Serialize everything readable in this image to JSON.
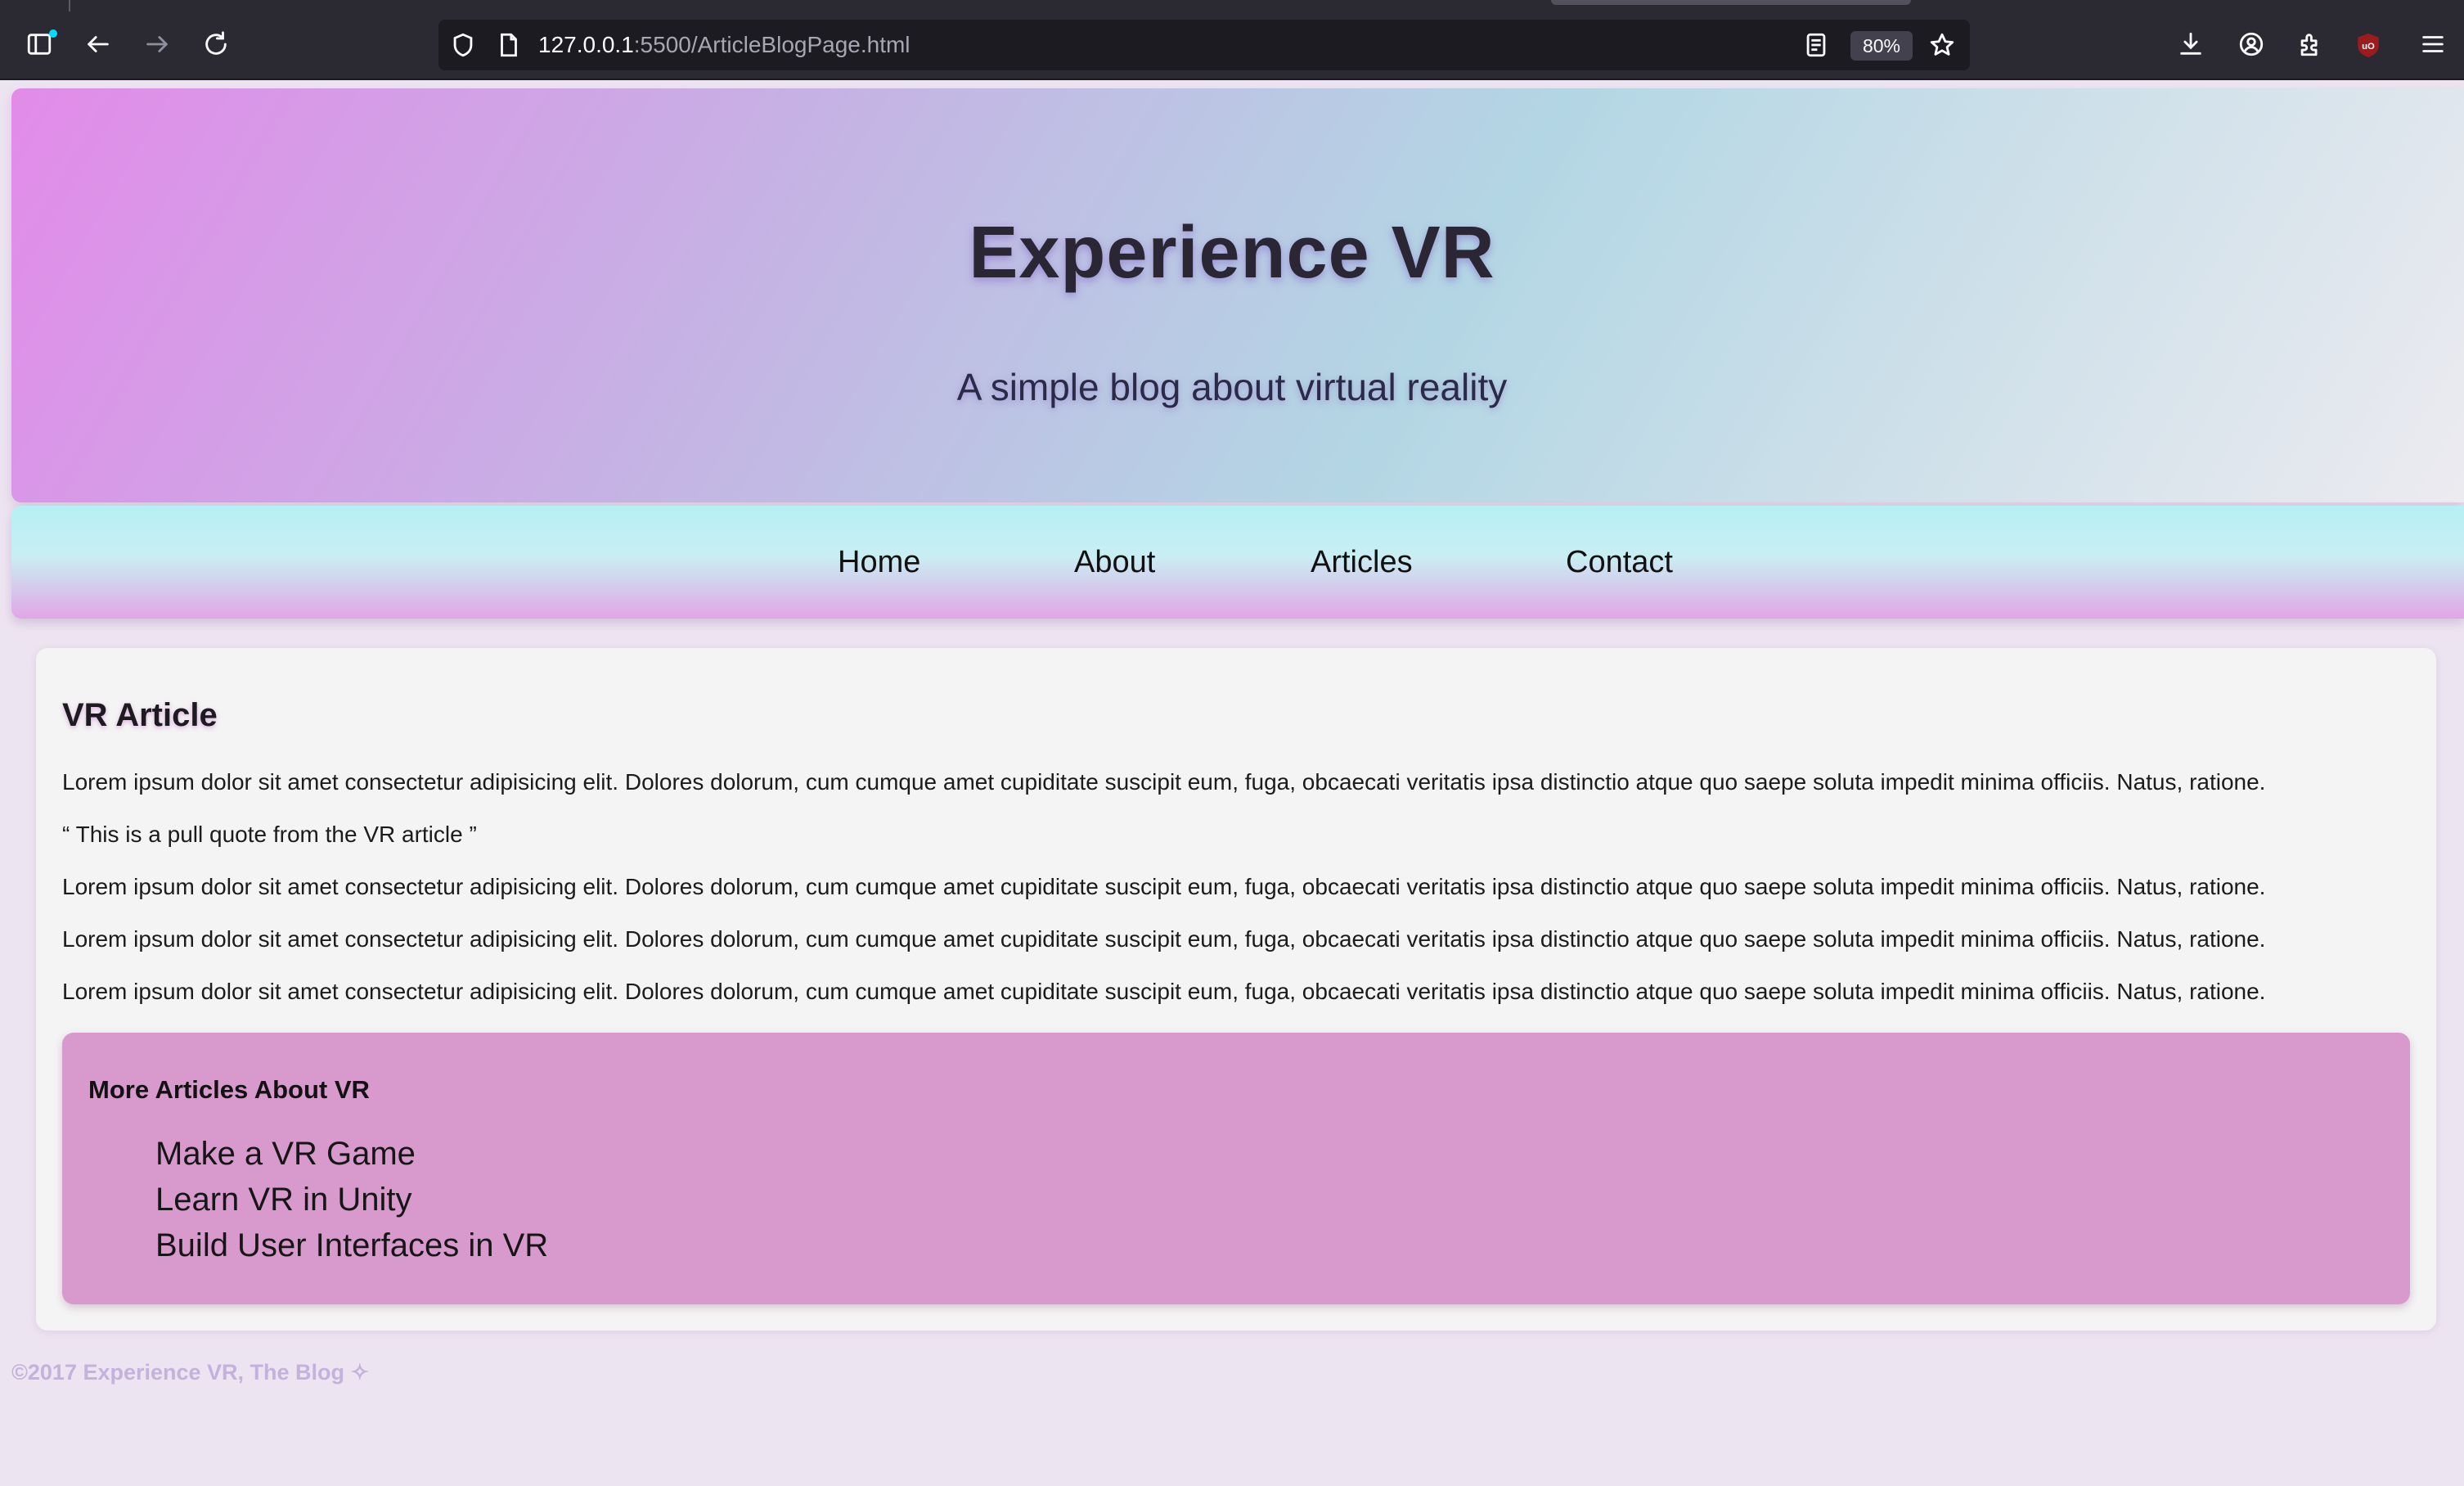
{
  "browser": {
    "url_host": "127.0.0.1",
    "url_path": ":5500/ArticleBlogPage.html",
    "zoom": "80%",
    "icons": {
      "sidebar": "sidebar-icon",
      "back": "back-arrow-icon",
      "forward": "forward-arrow-icon",
      "reload": "reload-icon",
      "shield": "shield-icon",
      "page": "page-icon",
      "reader": "reader-view-icon",
      "bookmark": "star-icon",
      "downloads": "download-icon",
      "account": "account-icon",
      "extensions": "extensions-icon",
      "ublock": "ublock-icon",
      "menu": "hamburger-menu-icon"
    }
  },
  "header": {
    "title": "Experience VR",
    "subtitle": "A simple blog about virtual reality"
  },
  "nav": {
    "items": [
      {
        "label": "Home"
      },
      {
        "label": "About"
      },
      {
        "label": "Articles"
      },
      {
        "label": "Contact"
      }
    ]
  },
  "article": {
    "title": "VR Article",
    "paragraphs": [
      "Lorem ipsum dolor sit amet consectetur adipisicing elit. Dolores dolorum, cum cumque amet cupiditate suscipit eum, fuga, obcaecati veritatis ipsa distinctio atque quo saepe soluta impedit minima officiis. Natus, ratione.",
      "Lorem ipsum dolor sit amet consectetur adipisicing elit. Dolores dolorum, cum cumque amet cupiditate suscipit eum, fuga, obcaecati veritatis ipsa distinctio atque quo saepe soluta impedit minima officiis. Natus, ratione.",
      "Lorem ipsum dolor sit amet consectetur adipisicing elit. Dolores dolorum, cum cumque amet cupiditate suscipit eum, fuga, obcaecati veritatis ipsa distinctio atque quo saepe soluta impedit minima officiis. Natus, ratione.",
      "Lorem ipsum dolor sit amet consectetur adipisicing elit. Dolores dolorum, cum cumque amet cupiditate suscipit eum, fuga, obcaecati veritatis ipsa distinctio atque quo saepe soluta impedit minima officiis. Natus, ratione."
    ],
    "pull_quote": "“ This is a pull quote from the VR article ”"
  },
  "more_articles": {
    "title": "More Articles About VR",
    "links": [
      {
        "label": "Make a VR Game"
      },
      {
        "label": "Learn VR in Unity"
      },
      {
        "label": "Build User Interfaces in VR"
      }
    ]
  },
  "footer": {
    "text": "©2017 Experience VR, The Blog ✧"
  },
  "colors": {
    "page_background": "#ede4f1",
    "hero_gradient_start": "#e28be9",
    "hero_gradient_end": "#ecebf0",
    "nav_gradient_top": "#b5f0f4",
    "nav_gradient_bottom": "#e1a6e6",
    "more_box": "#d89acc",
    "footer_text": "#c2b2dc"
  }
}
